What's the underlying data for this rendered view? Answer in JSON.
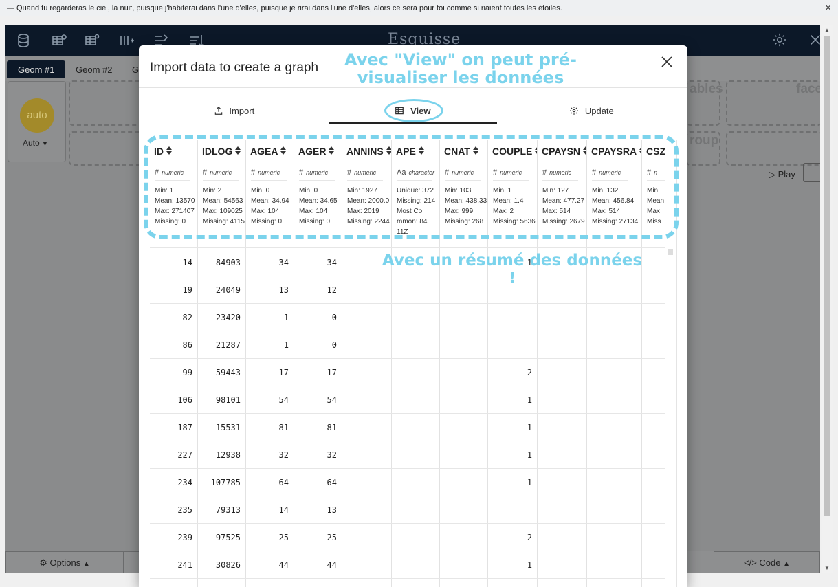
{
  "notice": {
    "text": "— Quand tu regarderas le ciel, la nuit, puisque j'habiterai dans l'une d'elles, puisque je rirai dans l'une d'elles, alors ce sera pour toi comme si riaient toutes les étoiles.",
    "close": "×"
  },
  "app": {
    "brand": "Esquisse",
    "geom_tabs": [
      "Geom #1",
      "Geom #2",
      "G"
    ],
    "auto_circle": "auto",
    "auto_label": "Auto",
    "dropzones": [
      "ables",
      "face",
      "roup"
    ],
    "play_label": "Play",
    "bottom": {
      "options": "Options",
      "code": "Code"
    }
  },
  "modal": {
    "title": "Import data to create a graph",
    "tabs": [
      {
        "label": "Import",
        "icon": "upload-icon"
      },
      {
        "label": "View",
        "icon": "table-icon"
      },
      {
        "label": "Update",
        "icon": "gear-icon"
      }
    ],
    "active_tab": "View"
  },
  "table": {
    "columns": [
      {
        "name": "ID",
        "type": "numeric",
        "stats": [
          "Min: 1",
          "Mean: 13570",
          "Max: 271407",
          "Missing: 0"
        ]
      },
      {
        "name": "IDLOG",
        "type": "numeric",
        "stats": [
          "Min: 2",
          "Mean: 54563",
          "Max: 109025",
          "Missing: 4115"
        ]
      },
      {
        "name": "AGEA",
        "type": "numeric",
        "stats": [
          "Min: 0",
          "Mean: 34.94",
          "Max: 104",
          "Missing: 0"
        ]
      },
      {
        "name": "AGER",
        "type": "numeric",
        "stats": [
          "Min: 0",
          "Mean: 34.65",
          "Max: 104",
          "Missing: 0"
        ]
      },
      {
        "name": "ANNINS",
        "type": "numeric",
        "stats": [
          "Min: 1927",
          "Mean: 2000.0",
          "Max: 2019",
          "Missing: 2244"
        ]
      },
      {
        "name": "APE",
        "type": "character",
        "stats": [
          "Unique: 372",
          "Missing: 214",
          "Most Co",
          "mmon: 84",
          "11Z"
        ]
      },
      {
        "name": "CNAT",
        "type": "numeric",
        "stats": [
          "Min: 103",
          "Mean: 438.33",
          "Max: 999",
          "Missing: 268"
        ]
      },
      {
        "name": "COUPLE",
        "type": "numeric",
        "stats": [
          "Min: 1",
          "Mean: 1.4",
          "Max: 2",
          "Missing: 5636"
        ]
      },
      {
        "name": "CPAYSN",
        "type": "numeric",
        "stats": [
          "Min: 127",
          "Mean: 477.27",
          "Max: 514",
          "Missing: 2679"
        ]
      },
      {
        "name": "CPAYSRA",
        "type": "numeric",
        "stats": [
          "Min: 132",
          "Mean: 456.84",
          "Max: 514",
          "Missing: 27134"
        ]
      },
      {
        "name": "CSZ",
        "type": "n",
        "stats": [
          "Min",
          "Mean",
          "Max",
          "Miss"
        ]
      }
    ],
    "rows": [
      [
        "14",
        "84903",
        "34",
        "34",
        "",
        "",
        "",
        "1",
        "",
        "",
        ""
      ],
      [
        "19",
        "24049",
        "13",
        "12",
        "",
        "",
        "",
        "",
        "",
        "",
        ""
      ],
      [
        "82",
        "23420",
        "1",
        "0",
        "",
        "",
        "",
        "",
        "",
        "",
        ""
      ],
      [
        "86",
        "21287",
        "1",
        "0",
        "",
        "",
        "",
        "",
        "",
        "",
        ""
      ],
      [
        "99",
        "59443",
        "17",
        "17",
        "",
        "",
        "",
        "2",
        "",
        "",
        ""
      ],
      [
        "106",
        "98101",
        "54",
        "54",
        "",
        "",
        "",
        "1",
        "",
        "",
        ""
      ],
      [
        "187",
        "15531",
        "81",
        "81",
        "",
        "",
        "",
        "1",
        "",
        "",
        ""
      ],
      [
        "227",
        "12938",
        "32",
        "32",
        "",
        "",
        "",
        "1",
        "",
        "",
        ""
      ],
      [
        "234",
        "107785",
        "64",
        "64",
        "",
        "",
        "",
        "1",
        "",
        "",
        ""
      ],
      [
        "235",
        "79313",
        "14",
        "13",
        "",
        "",
        "",
        "",
        "",
        "",
        ""
      ],
      [
        "239",
        "97525",
        "25",
        "25",
        "",
        "",
        "",
        "2",
        "",
        "",
        ""
      ],
      [
        "241",
        "30826",
        "44",
        "44",
        "",
        "",
        "",
        "1",
        "",
        "",
        ""
      ]
    ]
  },
  "annotations": {
    "view_note": "Avec \"View\" on peut pré-visualiser les données",
    "summary_note": "Avec un résumé des données !",
    "color": "#7bd3ec"
  }
}
